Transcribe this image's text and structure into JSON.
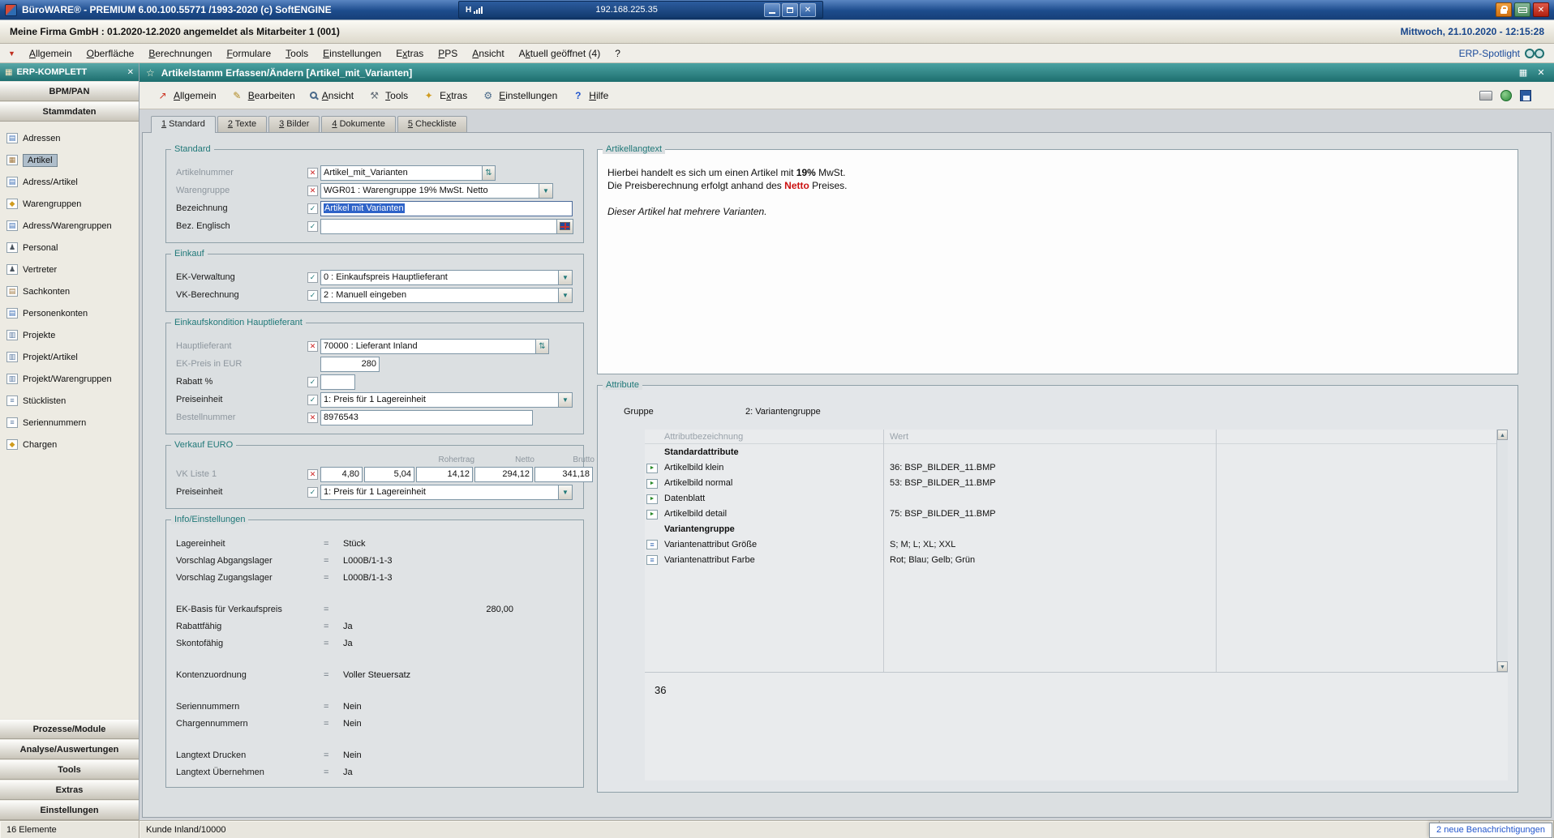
{
  "colors": {
    "titlebar_blue": "#1d4c8d",
    "teal_accent": "#1f7878",
    "red_highlight": "#cc1111",
    "selection_blue": "#2e63c8",
    "date_blue": "#17458a"
  },
  "icons": {
    "check": "✓",
    "cross": "✕",
    "close": "✕",
    "dropdown_arrow": "▼",
    "spinner": "⇅",
    "star": "☆",
    "equals": "=",
    "menu_arrow": "▼",
    "grid": "▦",
    "card": "▤",
    "box": "▦",
    "doc": "▥",
    "diamond": "◆",
    "person": "♟",
    "list": "≡",
    "arrow_ne": "↗",
    "pencil": "✎",
    "hammer": "⚒",
    "sparkle": "✦",
    "gear": "⚙",
    "question": "?",
    "up": "▲",
    "down": "▼",
    "play": "►"
  },
  "titlebar": {
    "title": "BüroWARE® - PREMIUM  6.00.100.55771 /1993-2020 (c) SoftENGINE",
    "network": "H",
    "ip": "192.168.225.35"
  },
  "company_bar": {
    "company": "Meine Firma GmbH : 01.2020-12.2020 angemeldet als Mitarbeiter 1 (001)",
    "datetime": "Mittwoch, 21.10.2020 - 12:15:28"
  },
  "menubar": {
    "items": [
      "Allgemein",
      "Oberfläche",
      "Berechnungen",
      "Formulare",
      "Tools",
      "Einstellungen",
      "Extras",
      "PPS",
      "Ansicht",
      "Aktuell geöffnet (4)",
      "?"
    ],
    "spotlight": "ERP-Spotlight"
  },
  "sidebar": {
    "header": "ERP-KOMPLETT",
    "section_bpm": "BPM/PAN",
    "section_stammdaten": "Stammdaten",
    "items": [
      "Adressen",
      "Artikel",
      "Adress/Artikel",
      "Warengruppen",
      "Adress/Warengruppen",
      "Personal",
      "Vertreter",
      "Sachkonten",
      "Personenkonten",
      "Projekte",
      "Projekt/Artikel",
      "Projekt/Warengruppen",
      "Stücklisten",
      "Seriennummern",
      "Chargen"
    ],
    "bottom_sections": [
      "Prozesse/Module",
      "Analyse/Auswertungen",
      "Tools",
      "Extras",
      "Einstellungen"
    ]
  },
  "window": {
    "title": "Artikelstamm Erfassen/Ändern [Artikel_mit_Varianten]",
    "toolbar": [
      "Allgemein",
      "Bearbeiten",
      "Ansicht",
      "Tools",
      "Extras",
      "Einstellungen",
      "Hilfe"
    ],
    "tabs": [
      "1 Standard",
      "2 Texte",
      "3 Bilder",
      "4 Dokumente",
      "5 Checkliste"
    ]
  },
  "form": {
    "standard": {
      "legend": "Standard",
      "artikelnummer_label": "Artikelnummer",
      "artikelnummer_value": "Artikel_mit_Varianten",
      "warengruppe_label": "Warengruppe",
      "warengruppe_value": "WGR01 : Warengruppe 19% MwSt. Netto",
      "bezeichnung_label": "Bezeichnung",
      "bezeichnung_value": "Artikel mit Varianten",
      "bez_englisch_label": "Bez. Englisch",
      "bez_englisch_value": ""
    },
    "einkauf": {
      "legend": "Einkauf",
      "ek_verwaltung_label": "EK-Verwaltung",
      "ek_verwaltung_value": "0 : Einkaufspreis Hauptlieferant",
      "vk_berechnung_label": "VK-Berechnung",
      "vk_berechnung_value": "2 : Manuell eingeben"
    },
    "ek_kondition": {
      "legend": "Einkaufskondition Hauptlieferant",
      "hauptlieferant_label": "Hauptlieferant",
      "hauptlieferant_value": "70000 : Lieferant Inland",
      "ek_preis_label": "EK-Preis in EUR",
      "ek_preis_value": "280",
      "rabatt_label": "Rabatt %",
      "rabatt_value": "",
      "preiseinheit_label": "Preiseinheit",
      "preiseinheit_value": "1: Preis für 1 Lagereinheit",
      "bestellnummer_label": "Bestellnummer",
      "bestellnummer_value": "8976543"
    },
    "verkauf": {
      "legend": "Verkauf EURO",
      "col_rohertrag": "Rohertrag",
      "col_netto": "Netto",
      "col_brutto": "Brutto",
      "vk_liste_label": "VK Liste 1",
      "vk_values": [
        "4,80",
        "5,04",
        "14,12",
        "294,12",
        "341,18"
      ],
      "preiseinheit_label": "Preiseinheit",
      "preiseinheit_value": "1: Preis für 1 Lagereinheit"
    },
    "info": {
      "legend": "Info/Einstellungen",
      "rows": [
        {
          "label": "Lagereinheit",
          "value": "Stück"
        },
        {
          "label": "Vorschlag Abgangslager",
          "value": "L000B/1-1-3"
        },
        {
          "label": "Vorschlag Zugangslager",
          "value": "L000B/1-1-3"
        },
        {
          "label": "EK-Basis für Verkaufspreis",
          "value": "280,00"
        },
        {
          "label": "Rabattfähig",
          "value": "Ja"
        },
        {
          "label": "Skontofähig",
          "value": "Ja"
        },
        {
          "label": "Kontenzuordnung",
          "value": "Voller Steuersatz"
        },
        {
          "label": "Seriennummern",
          "value": "Nein"
        },
        {
          "label": "Chargennummern",
          "value": "Nein"
        },
        {
          "label": "Langtext Drucken",
          "value": "Nein"
        },
        {
          "label": "Langtext Übernehmen",
          "value": "Ja"
        }
      ]
    },
    "langtext": {
      "legend": "Artikellangtext",
      "line1_pre": "Hierbei handelt es sich um einen Artikel mit ",
      "line1_bold": "19%",
      "line1_post": " MwSt.",
      "line2_pre": "Die Preisberechnung erfolgt anhand des ",
      "line2_red": "Netto",
      "line2_post": " Preises.",
      "line3_italic": "Dieser Artikel hat mehrere Varianten."
    },
    "attribute": {
      "legend": "Attribute",
      "gruppe_label": "Gruppe",
      "gruppe_value": "2: Variantengruppe",
      "col_name": "Attributbezeichnung",
      "col_wert": "Wert",
      "rows": [
        {
          "name": "Standardattribute",
          "wert": ""
        },
        {
          "name": "Artikelbild klein",
          "wert": "36: BSP_BILDER_11.BMP"
        },
        {
          "name": "Artikelbild normal",
          "wert": "53: BSP_BILDER_11.BMP"
        },
        {
          "name": "Datenblatt",
          "wert": ""
        },
        {
          "name": "Artikelbild detail",
          "wert": "75: BSP_BILDER_11.BMP"
        },
        {
          "name": "Variantengruppe",
          "wert": ""
        },
        {
          "name": "Variantenattribut Größe",
          "wert": "S; M; L; XL; XXL"
        },
        {
          "name": "Variantenattribut Farbe",
          "wert": "Rot; Blau; Gelb; Grün"
        }
      ],
      "detail_value": "36"
    }
  },
  "statusbar": {
    "elements": "16 Elemente",
    "context": "Kunde Inland/10000"
  },
  "notification": {
    "text": "2 neue Benachrichtigungen",
    "lang": "de"
  }
}
